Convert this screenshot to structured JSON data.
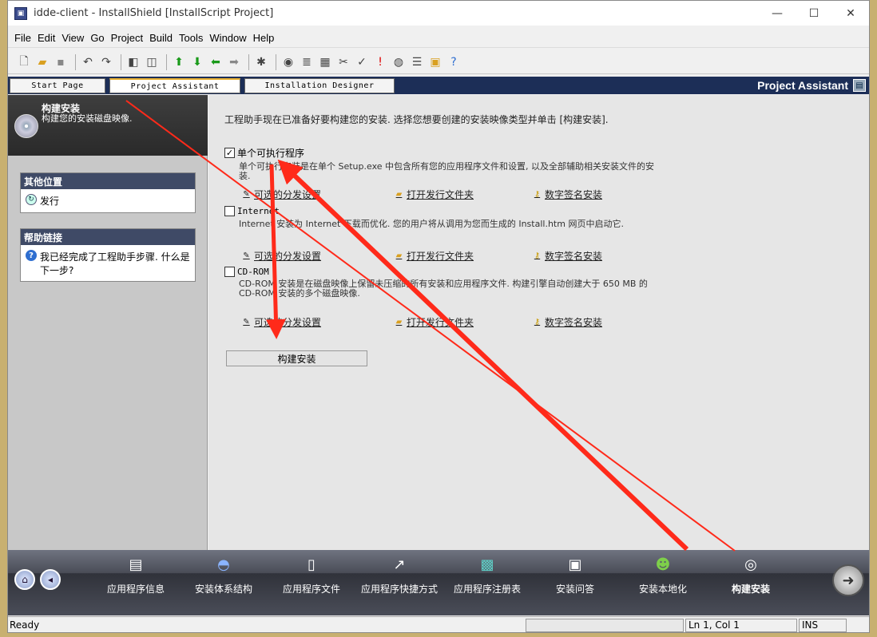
{
  "window": {
    "title": "idde-client - InstallShield [InstallScript Project]",
    "minimize": "—",
    "maximize": "☐",
    "close": "✕"
  },
  "menu": [
    "File",
    "Edit",
    "View",
    "Go",
    "Project",
    "Build",
    "Tools",
    "Window",
    "Help"
  ],
  "toolbar_icons": [
    "new-file-icon",
    "open-folder-icon",
    "save-icon",
    "undo-icon",
    "redo-icon",
    "panel-left-icon",
    "panel-split-icon",
    "up-arrow-icon",
    "down-arrow-icon",
    "left-arrow-icon",
    "right-arrow-icon",
    "bug-icon",
    "build-cd-icon",
    "release-icon",
    "calendar-icon",
    "stop-icon",
    "check-icon",
    "warning-icon",
    "globe-icon",
    "list-icon",
    "folder-icon",
    "help-icon"
  ],
  "tabs": [
    {
      "label": "Start Page"
    },
    {
      "label": "Project Assistant"
    },
    {
      "label": "Installation Designer"
    }
  ],
  "header_right": "Project Assistant",
  "left": {
    "title": "构建安装",
    "subtitle": "构建您的安装磁盘映像.",
    "box1": {
      "title": "其他位置",
      "item": "发行"
    },
    "box2": {
      "title": "帮助链接",
      "item": "我已经完成了工程助手步骤. 什么是下一步?"
    }
  },
  "main": {
    "intro": "工程助手现在已准备好要构建您的安装. 选择您想要创建的安装映像类型并单击 [构建安装].",
    "options": [
      {
        "label": "单个可执行程序",
        "checked": true,
        "desc": "单个可执行安装是在单个 Setup.exe 中包含所有您的应用程序文件和设置, 以及全部辅助相关安装文件的安装."
      },
      {
        "label": "Internet",
        "checked": false,
        "desc": "Internet 安装为 Internet 下载而优化. 您的用户将从调用为您而生成的 Install.htm 网页中启动它."
      },
      {
        "label": "CD-ROM",
        "checked": false,
        "desc": "CD-ROM 安装是在磁盘映像上保留未压缩的所有安装和应用程序文件. 构建引擎自动创建大于 650 MB 的 CD-ROM 安装的多个磁盘映像."
      }
    ],
    "links": {
      "dist": "可选的分发设置",
      "open_folder": "打开发行文件夹",
      "sign": "数字签名安装"
    },
    "build_button": "构建安装"
  },
  "bottom_nav": [
    {
      "label": "应用程序信息",
      "icon": "app-info-icon"
    },
    {
      "label": "安装体系结构",
      "icon": "architecture-icon"
    },
    {
      "label": "应用程序文件",
      "icon": "app-files-icon"
    },
    {
      "label": "应用程序快捷方式",
      "icon": "shortcut-icon"
    },
    {
      "label": "应用程序注册表",
      "icon": "registry-icon"
    },
    {
      "label": "安装问答",
      "icon": "interview-icon"
    },
    {
      "label": "安装本地化",
      "icon": "localization-icon"
    },
    {
      "label": "构建安装",
      "icon": "build-cd-icon",
      "active": true
    }
  ],
  "status": {
    "ready": "Ready",
    "position": "Ln 1, Col 1",
    "mode": "INS"
  },
  "annotation_color": "#ff2a1a"
}
